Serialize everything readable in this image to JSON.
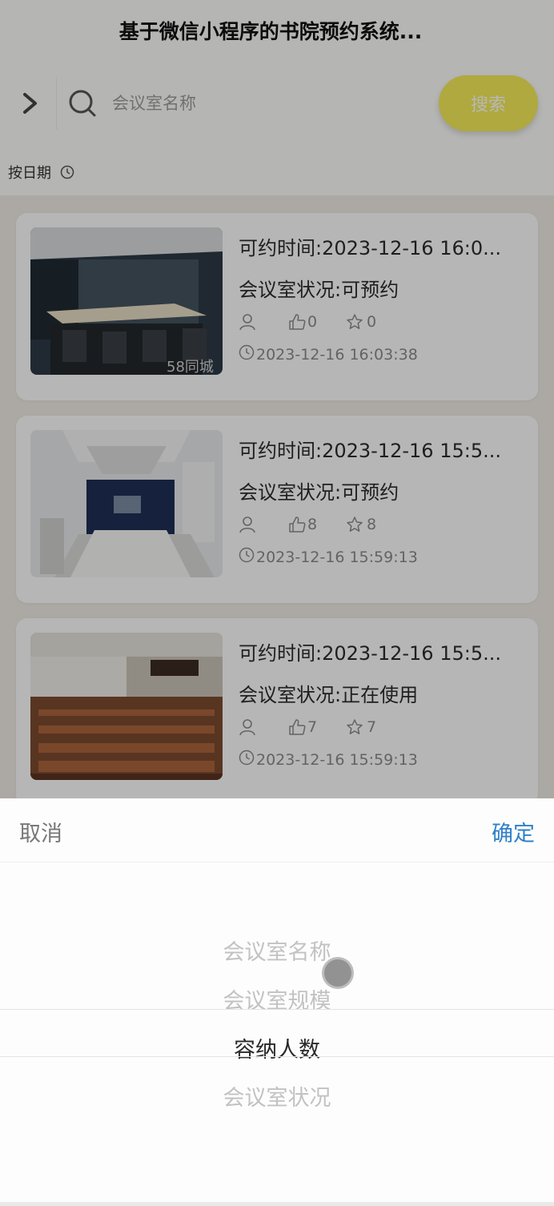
{
  "header": {
    "title": "基于微信小程序的书院预约系统..."
  },
  "search": {
    "placeholder": "会议室名称",
    "button_label": "搜索"
  },
  "sort": {
    "label": "按日期"
  },
  "cards": [
    {
      "time": "可约时间:2023-12-16 16:0...",
      "status": "会议室状况:可预约",
      "likes": "0",
      "favorites": "0",
      "date": "2023-12-16 16:03:38",
      "thumb_watermark": "58同城"
    },
    {
      "time": "可约时间:2023-12-16 15:5...",
      "status": "会议室状况:可预约",
      "likes": "8",
      "favorites": "8",
      "date": "2023-12-16 15:59:13"
    },
    {
      "time": "可约时间:2023-12-16 15:5...",
      "status": "会议室状况:正在使用",
      "likes": "7",
      "favorites": "7",
      "date": "2023-12-16 15:59:13"
    }
  ],
  "picker": {
    "cancel_label": "取消",
    "confirm_label": "确定",
    "options": [
      "会议室名称",
      "会议室规模",
      "容纳人数",
      "会议室状况"
    ],
    "selected_index": 2
  },
  "colors": {
    "search_button": "#f3ea58",
    "confirm": "#2f80c8"
  }
}
